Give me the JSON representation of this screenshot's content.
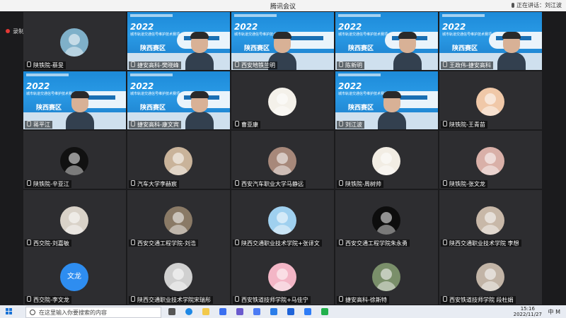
{
  "window": {
    "title": "腾讯会议",
    "speaking": "正在讲话：刘江波"
  },
  "recording": {
    "label": "录制中"
  },
  "banner": {
    "year": "2022",
    "subtitle": "城市轨道交通信号维护技术赛项",
    "region": "陕西赛区"
  },
  "tiles": [
    {
      "name": "陕铁院-蔡旻",
      "kind": "avatar",
      "bg": "#7fb0c9"
    },
    {
      "name": "捷安高科-樊晓峰",
      "kind": "video"
    },
    {
      "name": "西安地铁兰明",
      "kind": "video"
    },
    {
      "name": "陈新明",
      "kind": "video"
    },
    {
      "name": "王政伟-捷安高科",
      "kind": "video"
    },
    {
      "name": "蒋平江",
      "kind": "video"
    },
    {
      "name": "捷安高科-康文宾",
      "kind": "video"
    },
    {
      "name": "曹亚康",
      "kind": "avatar",
      "bg": "#f4f1ea"
    },
    {
      "name": "刘江波",
      "kind": "video"
    },
    {
      "name": "陕铁院-王青苗",
      "kind": "avatar",
      "bg": "#f0c8a8"
    },
    {
      "name": "陕铁院-辛亚江",
      "kind": "avatar",
      "bg": "#111111"
    },
    {
      "name": "汽车大学李赫宸",
      "kind": "avatar",
      "bg": "#c9b39a"
    },
    {
      "name": "西安汽车职业大学马静远",
      "kind": "avatar",
      "bg": "#a7887a"
    },
    {
      "name": "陕铁院-周树帅",
      "kind": "avatar",
      "bg": "#f2ede4"
    },
    {
      "name": "陕铁院-张文龙",
      "kind": "avatar",
      "bg": "#d9b0a8"
    },
    {
      "name": "西交院-刘嘉敏",
      "kind": "avatar",
      "bg": "#d9d2c8"
    },
    {
      "name": "西安交通工程学院-刘浩",
      "kind": "avatar",
      "bg": "#8a7a66"
    },
    {
      "name": "陕西交通职业技术学院+张译文",
      "kind": "avatar",
      "bg": "#9fd0ef"
    },
    {
      "name": "西安交通工程学院朱永勇",
      "kind": "avatar",
      "bg": "#0d0d0d"
    },
    {
      "name": "陕西交通职业技术学院 李想",
      "kind": "avatar",
      "bg": "#c8b8a8"
    },
    {
      "name": "西交院-李文龙",
      "kind": "text",
      "initials": "文龙",
      "bg": "#2e8df0"
    },
    {
      "name": "陕西交通职业技术学院宋瑞彤",
      "kind": "avatar",
      "bg": "#d0d0d0"
    },
    {
      "name": "西安铁道技师学院+马佳宁",
      "kind": "avatar",
      "bg": "#f3b6c6"
    },
    {
      "name": "捷安高科-徐斯特",
      "kind": "avatar",
      "bg": "#7a8f6a"
    },
    {
      "name": "西安铁道技师学院 段杜娟",
      "kind": "avatar",
      "bg": "#c2b4a6"
    }
  ],
  "taskbar": {
    "search_placeholder": "在这里输入你要搜索的内容",
    "time": "15:16",
    "date": "2022/11/27",
    "ime": "中",
    "tray_icon": "M"
  }
}
